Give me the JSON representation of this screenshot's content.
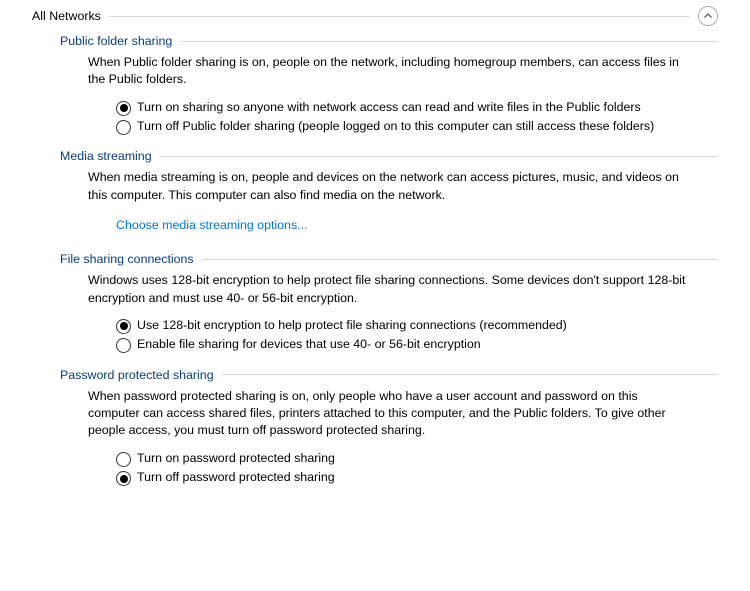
{
  "main": {
    "title": "All Networks"
  },
  "groups": {
    "publicFolderSharing": {
      "title": "Public folder sharing",
      "desc": "When Public folder sharing is on, people on the network, including homegroup members, can access files in the Public folders.",
      "options": [
        {
          "label": "Turn on sharing so anyone with network access can read and write files in the Public folders",
          "selected": true
        },
        {
          "label": "Turn off Public folder sharing (people logged on to this computer can still access these folders)",
          "selected": false
        }
      ]
    },
    "mediaStreaming": {
      "title": "Media streaming",
      "desc": "When media streaming is on, people and devices on the network can access pictures, music, and videos on this computer. This computer can also find media on the network.",
      "link": "Choose media streaming options..."
    },
    "fileSharingConnections": {
      "title": "File sharing connections",
      "desc": "Windows uses 128-bit encryption to help protect file sharing connections. Some devices don't support 128-bit encryption and must use 40- or 56-bit encryption.",
      "options": [
        {
          "label": "Use 128-bit encryption to help protect file sharing connections (recommended)",
          "selected": true
        },
        {
          "label": "Enable file sharing for devices that use 40- or 56-bit encryption",
          "selected": false
        }
      ]
    },
    "passwordProtectedSharing": {
      "title": "Password protected sharing",
      "desc": "When password protected sharing is on, only people who have a user account and password on this computer can access shared files, printers attached to this computer, and the Public folders. To give other people access, you must turn off password protected sharing.",
      "options": [
        {
          "label": "Turn on password protected sharing",
          "selected": false
        },
        {
          "label": "Turn off password protected sharing",
          "selected": true
        }
      ]
    }
  }
}
